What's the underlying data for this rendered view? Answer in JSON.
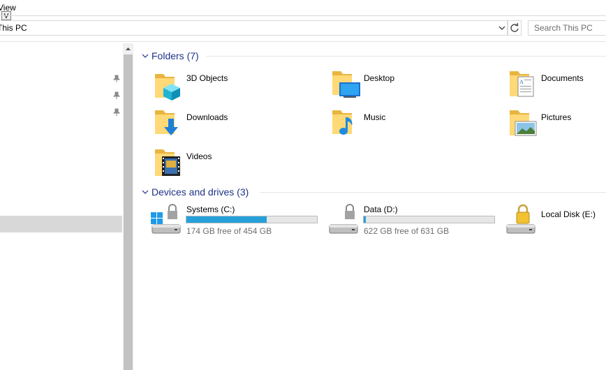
{
  "ribbon": {
    "tab_view": "View",
    "keytip": "V"
  },
  "address_bar": {
    "path": "This PC",
    "search_placeholder": "Search This PC"
  },
  "folders": {
    "header": "Folders (7)",
    "items": [
      {
        "label": "3D Objects",
        "icon": "3d-objects-folder-icon"
      },
      {
        "label": "Desktop",
        "icon": "desktop-folder-icon"
      },
      {
        "label": "Documents",
        "icon": "documents-folder-icon"
      },
      {
        "label": "Downloads",
        "icon": "downloads-folder-icon"
      },
      {
        "label": "Music",
        "icon": "music-folder-icon"
      },
      {
        "label": "Pictures",
        "icon": "pictures-folder-icon"
      },
      {
        "label": "Videos",
        "icon": "videos-folder-icon"
      }
    ]
  },
  "drives": {
    "header": "Devices and drives (3)",
    "items": [
      {
        "label": "Systems (C:)",
        "free_text": "174 GB free of 454 GB",
        "used_fraction": 0.617,
        "icon": "windows-drive-icon"
      },
      {
        "label": "Data (D:)",
        "free_text": "622 GB free of 631 GB",
        "used_fraction": 0.014,
        "icon": "hard-drive-icon"
      },
      {
        "label": "Local Disk (E:)",
        "icon": "locked-drive-icon"
      }
    ]
  },
  "colors": {
    "accent": "#26a0da",
    "header_text": "#1e3287"
  }
}
